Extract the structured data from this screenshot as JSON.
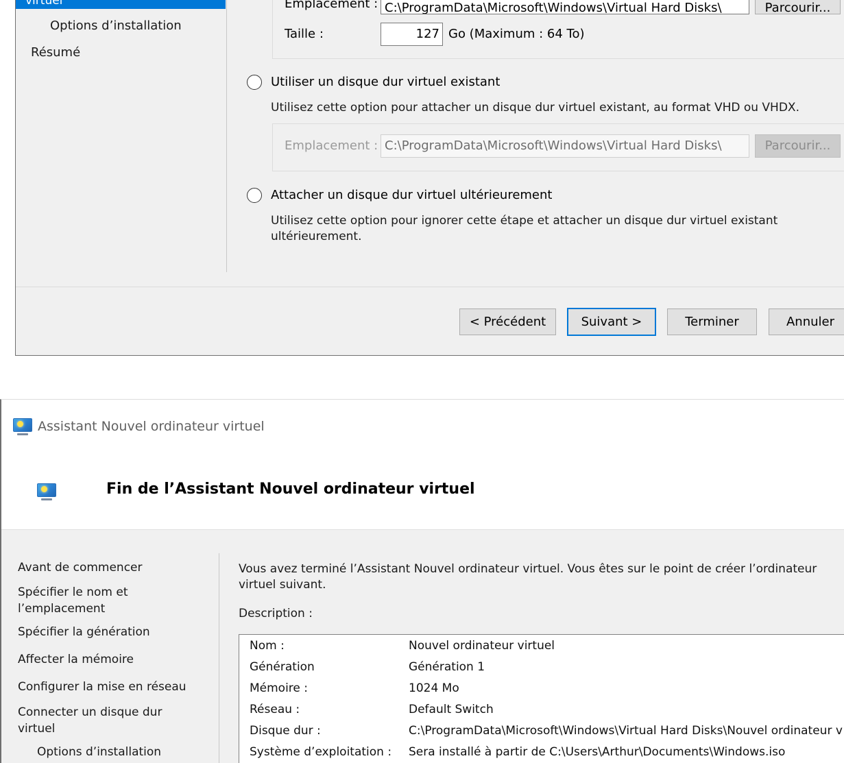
{
  "top_dialog": {
    "nav_selected_label": "virtuel",
    "nav_items": [
      "Options d’installation",
      "Résumé"
    ],
    "create_disk": {
      "location_label": "Emplacement :",
      "location_value": "C:\\ProgramData\\Microsoft\\Windows\\Virtual Hard Disks\\",
      "browse_label": "Parcourir...",
      "size_label": "Taille :",
      "size_value": "127",
      "size_unit": "Go (Maximum : 64 To)"
    },
    "existing_disk": {
      "radio_label": "Utiliser un disque dur virtuel existant",
      "description": "Utilisez cette option pour attacher un disque dur virtuel existant, au format VHD ou VHDX.",
      "location_label": "Emplacement :",
      "location_value": "C:\\ProgramData\\Microsoft\\Windows\\Virtual Hard Disks\\",
      "browse_label": "Parcourir..."
    },
    "attach_later": {
      "radio_label": "Attacher un disque dur virtuel ultérieurement",
      "description": "Utilisez cette option pour ignorer cette étape et attacher un disque dur virtuel existant ultérieurement."
    },
    "buttons": {
      "previous": "< Précédent",
      "next": "Suivant >",
      "finish": "Terminer",
      "cancel": "Annuler"
    }
  },
  "bottom_dialog": {
    "window_title": "Assistant Nouvel ordinateur virtuel",
    "header_title": "Fin de l’Assistant Nouvel ordinateur virtuel",
    "nav_items": [
      "Avant de commencer",
      "Spécifier le nom et l’emplacement",
      "Spécifier la génération",
      "Affecter la mémoire",
      "Configurer la mise en réseau",
      "Connecter un disque dur virtuel",
      "Options d’installation"
    ],
    "intro": "Vous avez terminé l’Assistant Nouvel ordinateur virtuel. Vous êtes sur le point de créer l’ordinateur virtuel suivant.",
    "description_label": "Description :",
    "summary": [
      {
        "key": "Nom :",
        "value": "Nouvel ordinateur virtuel"
      },
      {
        "key": "Génération",
        "value": "Génération 1"
      },
      {
        "key": "Mémoire :",
        "value": "1024 Mo"
      },
      {
        "key": "Réseau :",
        "value": "Default Switch"
      },
      {
        "key": "Disque dur :",
        "value": "C:\\ProgramData\\Microsoft\\Windows\\Virtual Hard Disks\\Nouvel ordinateur v"
      },
      {
        "key": "Système d’exploitation :",
        "value": "Sera installé à partir de C:\\Users\\Arthur\\Documents\\Windows.iso"
      }
    ]
  },
  "colors": {
    "selection_blue": "#0078d7",
    "dialog_background": "#f0f0f0",
    "default_button_border": "#0078d7"
  }
}
